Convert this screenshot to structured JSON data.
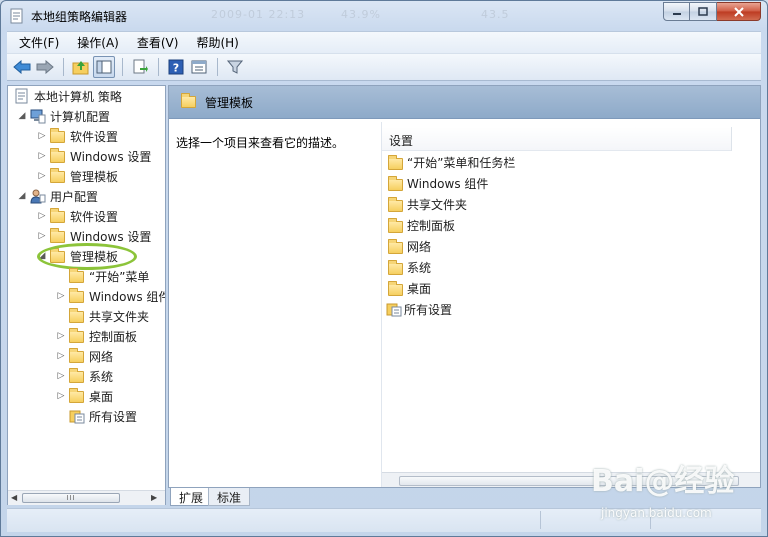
{
  "window": {
    "title": "本地组策略编辑器",
    "ghost_text": [
      "2009-01 22:13",
      "43.9%",
      "43.5"
    ]
  },
  "menubar": {
    "items": [
      {
        "label": "文件(F)"
      },
      {
        "label": "操作(A)"
      },
      {
        "label": "查看(V)"
      },
      {
        "label": "帮助(H)"
      }
    ]
  },
  "toolbar": {
    "icons": [
      "back-arrow-icon",
      "forward-arrow-icon",
      "up-folder-icon",
      "show-hide-tree-icon",
      "export-list-icon",
      "help-icon",
      "properties-pane-icon",
      "filter-icon"
    ]
  },
  "tree": {
    "root": "本地计算机 策略",
    "computer_config": "计算机配置",
    "user_config": "用户配置",
    "software_settings": "软件设置",
    "windows_settings": "Windows 设置",
    "admin_templates": "管理模板",
    "sub_items": [
      "“开始”菜单",
      "Windows 组件",
      "共享文件夹",
      "控制面板",
      "网络",
      "系统",
      "桌面",
      "所有设置"
    ]
  },
  "right_pane": {
    "header_title": "管理模板",
    "description": "选择一个项目来查看它的描述。",
    "column_header": "设置",
    "items": [
      "“开始”菜单和任务栏",
      "Windows 组件",
      "共享文件夹",
      "控制面板",
      "网络",
      "系统",
      "桌面",
      "所有设置"
    ]
  },
  "tabs": {
    "extended": "扩展",
    "standard": "标准"
  },
  "scrollbar_grip": "III",
  "watermark": {
    "main": "Bai@经验",
    "sub": "jingyan.baidu.com"
  },
  "colors": {
    "header_blue": "#8eaac9",
    "folder_yellow": "#f6cf5f",
    "highlight_green": "#8cc43a"
  }
}
